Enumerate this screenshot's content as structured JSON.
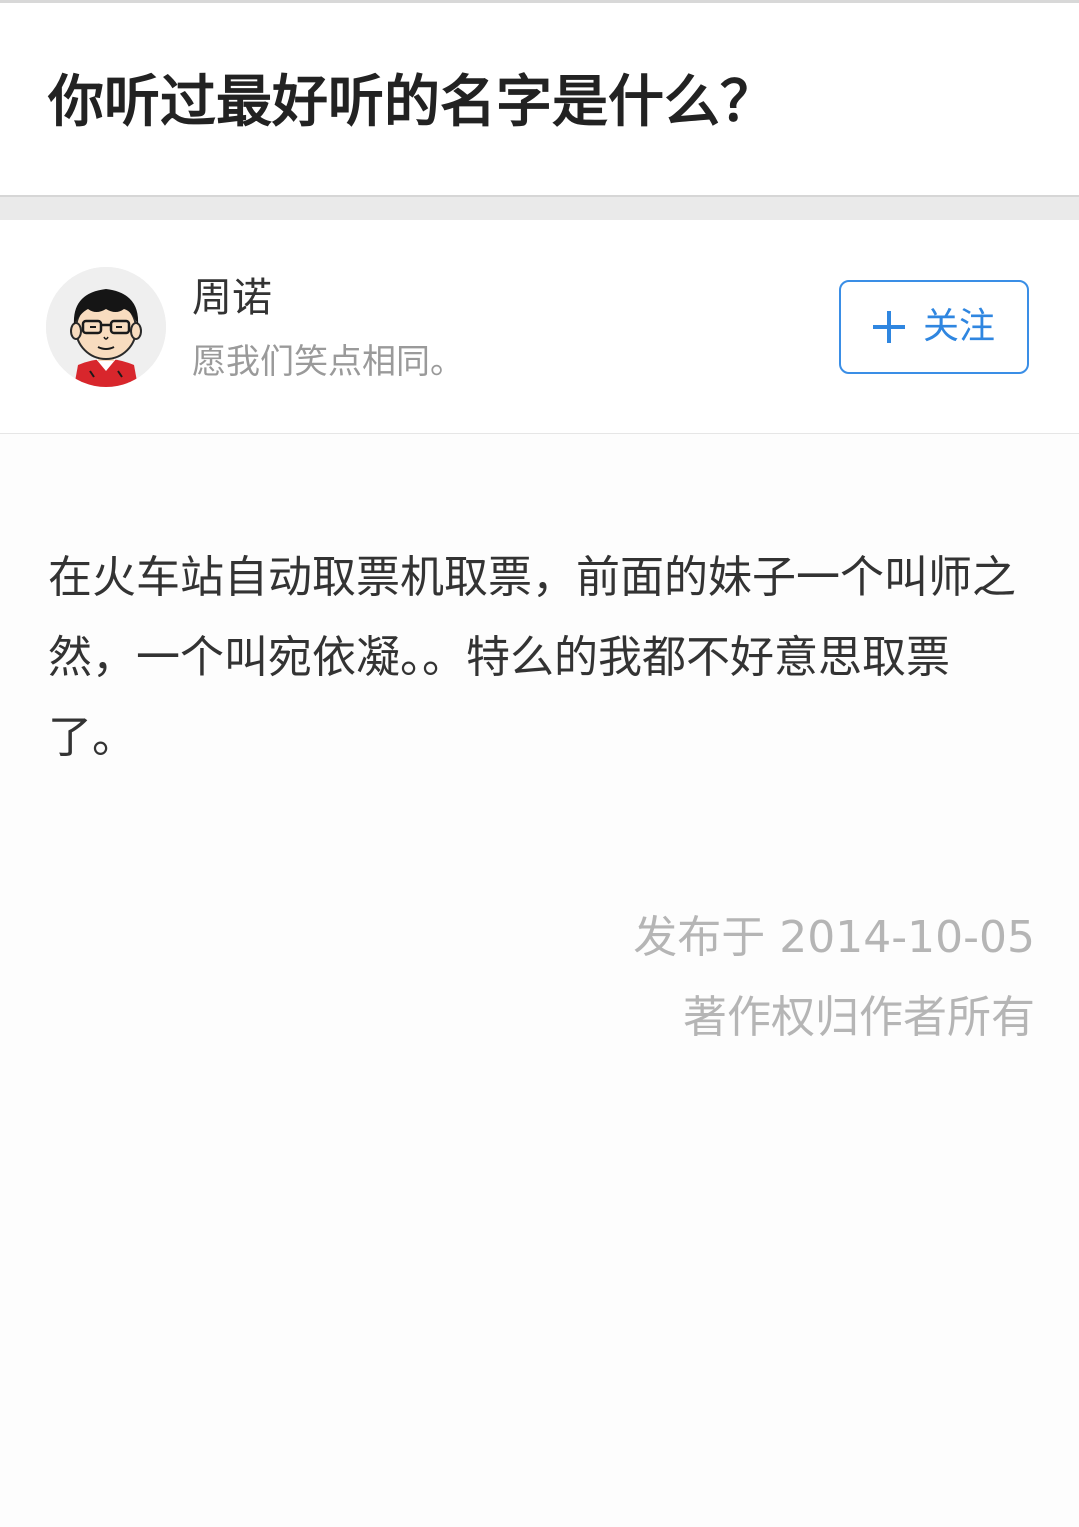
{
  "question": {
    "title": "你听过最好听的名字是什么？"
  },
  "author": {
    "name": "周诺",
    "bio": "愿我们笑点相同。",
    "avatar_icon": "cartoon-boy-with-glasses-avatar"
  },
  "follow_button": {
    "icon": "plus-icon",
    "label": "关注",
    "accent_color": "#2f86e0"
  },
  "answer": {
    "text": "在火车站自动取票机取票，前面的妹子一个叫师之然，一个叫宛依凝。。特么的我都不好意思取票了。"
  },
  "meta": {
    "published": "发布于 2014-10-05",
    "copyright": "著作权归作者所有"
  }
}
